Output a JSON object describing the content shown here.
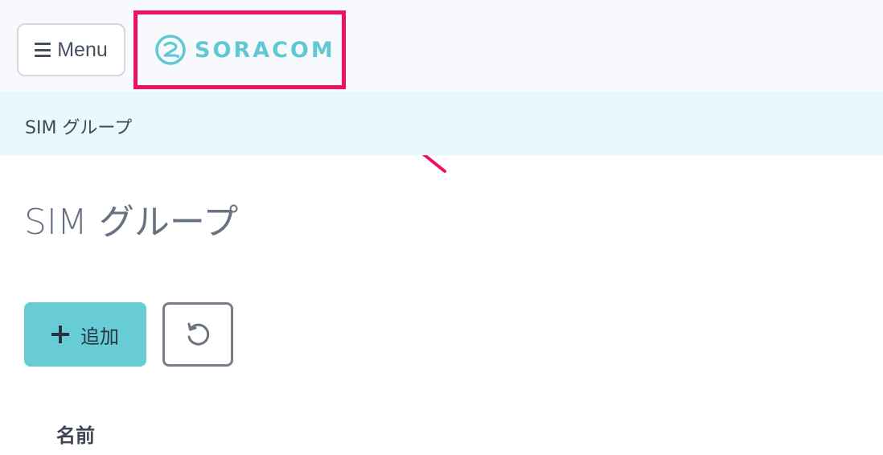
{
  "header": {
    "menu_label": "Menu",
    "logo_text": "SORACOM"
  },
  "breadcrumb": {
    "current": "SIM グループ"
  },
  "page": {
    "title": "SIM グループ"
  },
  "toolbar": {
    "add_label": "追加",
    "refresh_icon": "refresh-icon"
  },
  "table": {
    "columns": [
      "名前"
    ]
  },
  "colors": {
    "brand": "#5fc8d2",
    "primary_button": "#67ccd6",
    "annotation": "#ee0f62",
    "breadcrumb_bg": "#e9f8fc",
    "topbar_bg": "#f7f9fd"
  }
}
